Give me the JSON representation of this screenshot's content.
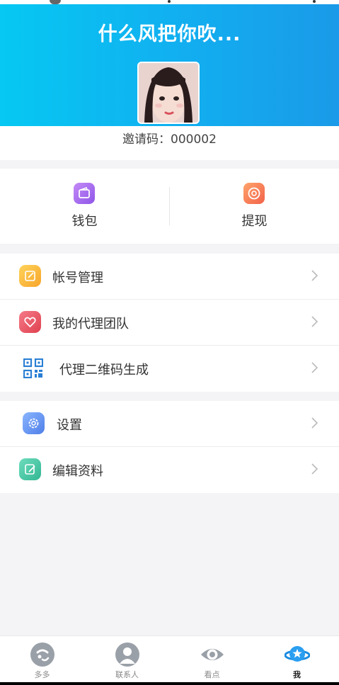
{
  "header": {
    "title": "什么风把你吹..."
  },
  "profile": {
    "invite_label": "邀请码：",
    "invite_code": "000002"
  },
  "wallet_section": {
    "items": [
      {
        "label": "钱包",
        "icon": "wallet-icon",
        "color": "#a66bf0"
      },
      {
        "label": "提现",
        "icon": "withdraw-icon",
        "color": "#f57a4a"
      }
    ]
  },
  "menu_group_1": [
    {
      "label": "帐号管理",
      "icon": "edit-account-icon",
      "color": "#f8b333"
    },
    {
      "label": "我的代理团队",
      "icon": "heart-icon",
      "color": "#ea4f63"
    },
    {
      "label": "代理二维码生成",
      "icon": "qr-code-icon",
      "color": "#2a7fd4"
    }
  ],
  "menu_group_2": [
    {
      "label": "设置",
      "icon": "gear-icon",
      "color": "#5b8ff3"
    },
    {
      "label": "编辑资料",
      "icon": "edit-profile-icon",
      "color": "#3fc3a3"
    }
  ],
  "tabbar": {
    "tabs": [
      {
        "label": "多多",
        "icon": "duoduo-icon"
      },
      {
        "label": "联系人",
        "icon": "contacts-icon"
      },
      {
        "label": "看点",
        "icon": "eye-icon"
      },
      {
        "label": "我",
        "icon": "planet-icon",
        "active": true
      }
    ]
  },
  "colors": {
    "header_start": "#06c8f2",
    "header_end": "#1a9ae8",
    "page_bg": "#f4f4f6"
  }
}
